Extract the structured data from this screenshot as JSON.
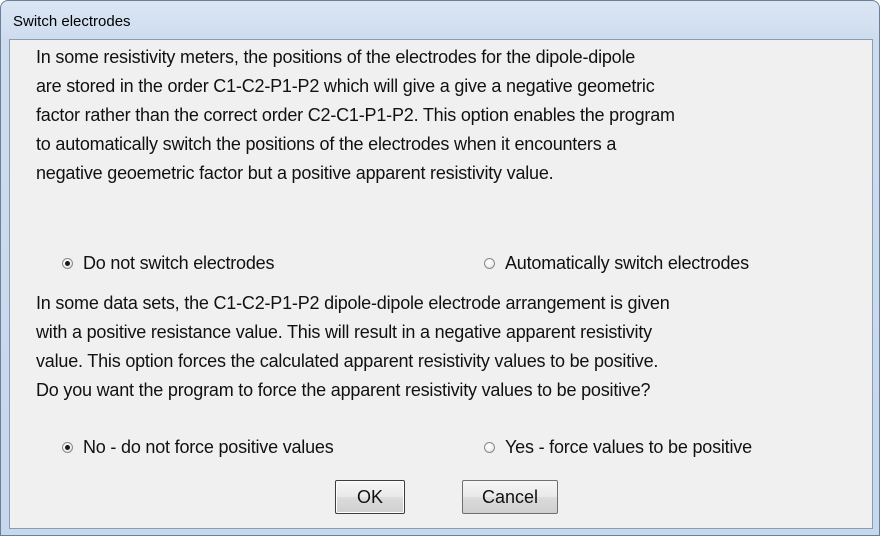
{
  "window": {
    "title": "Switch electrodes"
  },
  "section1": {
    "lines": [
      "In some resistivity meters, the positions of the electrodes for the dipole-dipole",
      "are stored in the order C1-C2-P1-P2 which will give a give a negative geometric",
      "factor rather than the correct order C2-C1-P1-P2. This option enables the program",
      "to automatically switch the positions of the electrodes when it encounters a",
      "negative geoemetric factor but a positive apparent resistivity value."
    ],
    "options": [
      {
        "label": "Do not switch electrodes",
        "checked": true
      },
      {
        "label": "Automatically switch electrodes",
        "checked": false
      }
    ]
  },
  "section2": {
    "lines": [
      "In some data sets, the C1-C2-P1-P2 dipole-dipole electrode arrangement is given",
      "with a positive resistance value. This will result in a negative apparent resistivity",
      "value. This option forces the calculated apparent resistivity values to be positive.",
      "Do you want the program to force the apparent resistivity values to be positive?"
    ],
    "options": [
      {
        "label": "No - do not force positive values",
        "checked": true
      },
      {
        "label": "Yes - force values to be positive",
        "checked": false
      }
    ]
  },
  "buttons": {
    "ok_label": "OK",
    "cancel_label": "Cancel"
  },
  "colors": {
    "dialog_background": "#f0f0f0",
    "frame": "#c7d7ec"
  }
}
